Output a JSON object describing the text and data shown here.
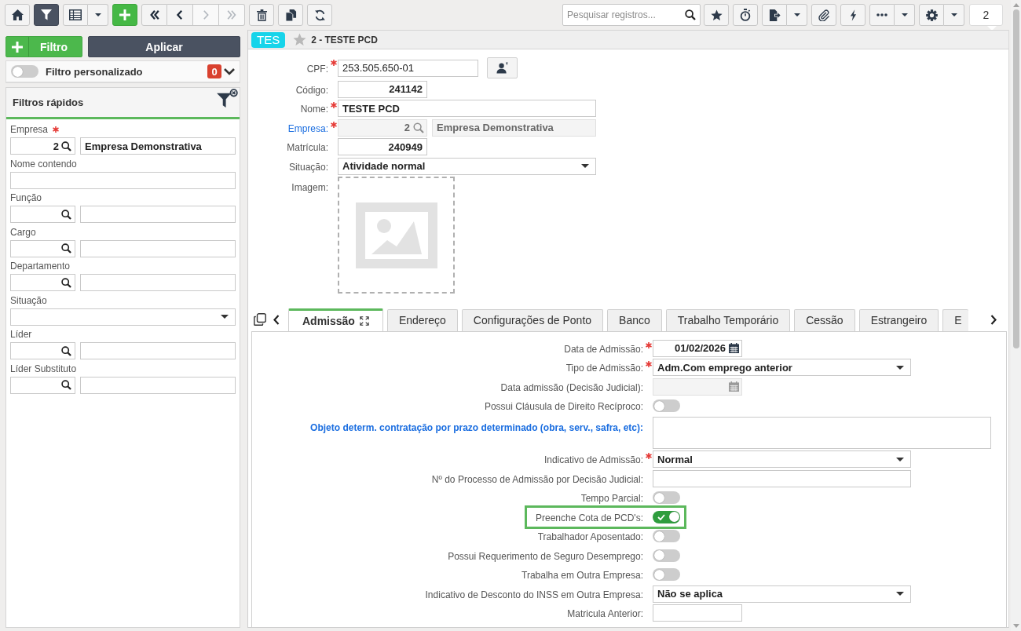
{
  "toolbar": {
    "filter_button": {
      "selected": true
    },
    "navigation_buttons": [
      {
        "kind": "first",
        "disabled": false
      },
      {
        "kind": "previous",
        "disabled": false
      },
      {
        "kind": "next",
        "disabled": true
      },
      {
        "kind": "last",
        "disabled": true
      }
    ],
    "search": {
      "placeholder": "Pesquisar registros..."
    },
    "record_count": "2"
  },
  "filter_panel": {
    "add_filter_button": "Filtro",
    "apply_button": "Aplicar",
    "custom_filter": {
      "label": "Filtro personalizado",
      "on": false,
      "count": "0"
    },
    "quick_filters": {
      "title": "Filtros rápidos",
      "fields": [
        {
          "label": "Empresa",
          "required": true,
          "kind": "lookup",
          "code": "2",
          "name": "Empresa Demonstrativa"
        },
        {
          "label": "Nome contendo",
          "required": false,
          "kind": "text"
        },
        {
          "label": "Função",
          "required": false,
          "kind": "lookup"
        },
        {
          "label": "Cargo",
          "required": false,
          "kind": "lookup"
        },
        {
          "label": "Departamento",
          "required": false,
          "kind": "lookup"
        },
        {
          "label": "Situação",
          "required": false,
          "kind": "select"
        },
        {
          "label": "Líder",
          "required": false,
          "kind": "lookup"
        },
        {
          "label": "Líder Substituto",
          "required": false,
          "kind": "lookup"
        }
      ]
    }
  },
  "record": {
    "badge": "TES",
    "favorite": false,
    "title": "2 - TESTE PCD",
    "fields": [
      {
        "label": "CPF:",
        "required": true,
        "link": false,
        "disabled": false,
        "kind": "document",
        "value": "253.505.650-01"
      },
      {
        "label": "Código:",
        "required": false,
        "link": false,
        "disabled": false,
        "kind": "number",
        "value": "241142"
      },
      {
        "label": "Nome:",
        "required": true,
        "link": false,
        "disabled": false,
        "kind": "text",
        "value": "TESTE PCD"
      },
      {
        "label": "Empresa:",
        "required": true,
        "link": true,
        "disabled": true,
        "kind": "lookup",
        "code": "2",
        "name": "Empresa Demonstrativa"
      },
      {
        "label": "Matrícula:",
        "required": false,
        "link": false,
        "disabled": false,
        "kind": "number",
        "value": "240949"
      },
      {
        "label": "Situação:",
        "required": false,
        "link": false,
        "disabled": false,
        "kind": "select",
        "value": "Atividade normal"
      },
      {
        "label": "Imagem:",
        "required": false,
        "link": false,
        "disabled": false,
        "kind": "image"
      }
    ]
  },
  "tabs": [
    {
      "label": "Admissão",
      "selected": true
    },
    {
      "label": "Endereço",
      "selected": false
    },
    {
      "label": "Configurações de Ponto",
      "selected": false
    },
    {
      "label": "Banco",
      "selected": false
    },
    {
      "label": "Trabalho Temporário",
      "selected": false
    },
    {
      "label": "Cessão",
      "selected": false
    },
    {
      "label": "Estrangeiro",
      "selected": false
    },
    {
      "label": "E",
      "selected": false
    }
  ],
  "admission": {
    "fields": [
      {
        "label": "Data de Admissão:",
        "required": true,
        "link": false,
        "disabled": false,
        "highlighted": false,
        "kind": "date",
        "value": "01/02/2026"
      },
      {
        "label": "Tipo de Admissão:",
        "required": true,
        "link": false,
        "disabled": false,
        "highlighted": false,
        "kind": "select",
        "value": "Adm.Com emprego anterior"
      },
      {
        "label": "Data admissão (Decisão Judicial):",
        "required": false,
        "link": false,
        "disabled": true,
        "highlighted": false,
        "kind": "date"
      },
      {
        "label": "Possui Cláusula de Direito Recíproco:",
        "required": false,
        "link": false,
        "disabled": false,
        "highlighted": false,
        "kind": "toggle",
        "on": false
      },
      {
        "label": "Objeto determ. contratação por prazo determinado (obra, serv., safra, etc):",
        "required": false,
        "link": true,
        "disabled": false,
        "highlighted": false,
        "kind": "textarea"
      },
      {
        "label": "Indicativo de Admissão:",
        "required": true,
        "link": false,
        "disabled": false,
        "highlighted": false,
        "kind": "select",
        "value": "Normal"
      },
      {
        "label": "Nº do Processo de Admissão por Decisão Judicial:",
        "required": false,
        "link": false,
        "disabled": false,
        "highlighted": false,
        "kind": "text"
      },
      {
        "label": "Tempo Parcial:",
        "required": false,
        "link": false,
        "disabled": false,
        "highlighted": false,
        "kind": "toggle",
        "on": false
      },
      {
        "label": "Preenche Cota de PCD's:",
        "required": false,
        "link": false,
        "disabled": false,
        "highlighted": true,
        "kind": "toggle",
        "on": true
      },
      {
        "label": "Trabalhador Aposentado:",
        "required": false,
        "link": false,
        "disabled": false,
        "highlighted": false,
        "kind": "toggle",
        "on": false
      },
      {
        "label": "Possui Requerimento de Seguro Desemprego:",
        "required": false,
        "link": false,
        "disabled": false,
        "highlighted": false,
        "kind": "toggle",
        "on": false
      },
      {
        "label": "Trabalha em Outra Empresa:",
        "required": false,
        "link": false,
        "disabled": false,
        "highlighted": false,
        "kind": "toggle",
        "on": false
      },
      {
        "label": "Indicativo de Desconto do INSS em Outra Empresa:",
        "required": false,
        "link": false,
        "disabled": false,
        "highlighted": false,
        "kind": "select",
        "value": "Não se aplica"
      },
      {
        "label": "Matricula Anterior:",
        "required": false,
        "link": false,
        "disabled": false,
        "highlighted": false,
        "kind": "short_text"
      }
    ]
  }
}
